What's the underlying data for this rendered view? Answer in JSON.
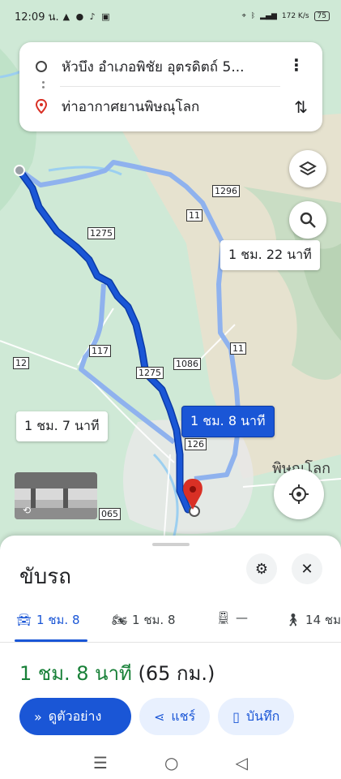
{
  "status_bar": {
    "time": "12:09 น.",
    "battery": "75",
    "net_speed": "172 K/s"
  },
  "route": {
    "origin": "หัวบึง อำเภอพิชัย อุตรดิตถ์ 5...",
    "destination": "ท่าอากาศยานพิษณุโลก"
  },
  "map": {
    "road_labels": [
      "1296",
      "11",
      "1275",
      "117",
      "12",
      "1275",
      "1086",
      "11",
      "126",
      "065"
    ],
    "town": "พิษณุโลก",
    "time_labels": {
      "alt_1": "1 ชม. 22 นาที",
      "alt_2": "1 ชม. 7 นาที",
      "selected": "1 ชม. 8 นาที"
    }
  },
  "sheet": {
    "title": "ขับรถ",
    "modes": [
      {
        "icon": "car-icon",
        "label": "1 ชม. 8"
      },
      {
        "icon": "motorcycle-icon",
        "label": "1 ชม. 8"
      },
      {
        "icon": "transit-icon",
        "label": "—"
      },
      {
        "icon": "walk-icon",
        "label": "14 ชม"
      }
    ],
    "duration": "1 ชม. 8 นาที",
    "distance": "(65 กม.)",
    "actions": {
      "preview": "ดูตัวอย่าง",
      "share": "แชร์",
      "save": "บันทึก"
    }
  },
  "colors": {
    "route_selected": "#1a56d6",
    "route_alt": "#8fb2ee",
    "duration_green": "#188038"
  }
}
